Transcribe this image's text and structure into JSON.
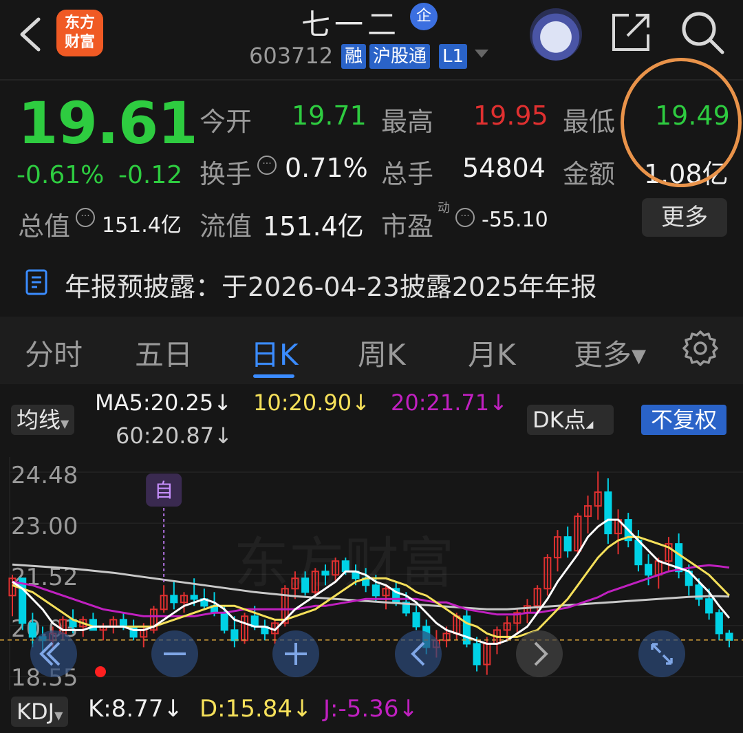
{
  "header": {
    "logo_line1": "东方",
    "logo_line2": "财富",
    "stock_name": "七一二",
    "enterprise_badge": "企",
    "stock_code": "603712",
    "tags": [
      "融",
      "沪股通",
      "L1"
    ]
  },
  "quote": {
    "price": "19.61",
    "change_pct": "-0.61%",
    "change_abs": "-0.12",
    "open_label": "今开",
    "open": "19.71",
    "high_label": "最高",
    "high": "19.95",
    "low_label": "最低",
    "low": "19.49",
    "turnover_label": "换手",
    "turnover": "0.71%",
    "volume_label": "总手",
    "volume": "54804",
    "amount_label": "金额",
    "amount": "1.08亿",
    "total_cap_label": "总值",
    "total_cap": "151.4亿",
    "float_cap_label": "流值",
    "float_cap": "151.4亿",
    "pe_label": "市盈",
    "pe_sup": "动",
    "pe": "-55.10",
    "more_label": "更多"
  },
  "notice": {
    "text": "年报预披露：于2026-04-23披露2025年年报"
  },
  "tabs": [
    {
      "label": "分时"
    },
    {
      "label": "五日"
    },
    {
      "label": "日K",
      "active": true
    },
    {
      "label": "周K"
    },
    {
      "label": "月K"
    },
    {
      "label": "更多▾"
    }
  ],
  "ma_legend": {
    "selector": "均线",
    "ma5": "MA5:20.25↓",
    "ma10": "10:20.90↓",
    "ma20": "20:21.71↓",
    "ma60": "60:20.87↓",
    "dk_label": "DK点",
    "adjust_label": "不复权"
  },
  "colors": {
    "up": "#e03030",
    "down": "#00d2e6",
    "price_green": "#2ecc40",
    "ma5": "#ffffff",
    "ma10": "#f5e05a",
    "ma20": "#c020c0",
    "ma60": "#c8c8c8",
    "accent": "#3b8cff"
  },
  "chart_data": {
    "type": "candlestick",
    "y_ticks": [
      "24.48",
      "23.00",
      "21.52",
      "20.03",
      "18.55"
    ],
    "ylim": [
      18.55,
      24.48
    ],
    "watermark": "东方财富",
    "marker_label": "自",
    "candles": [
      [
        20.9,
        21.5,
        20.3,
        21.4
      ],
      [
        21.4,
        21.4,
        19.9,
        20.1
      ],
      [
        20.1,
        20.4,
        19.4,
        19.7
      ],
      [
        19.7,
        20.0,
        19.3,
        19.6
      ],
      [
        19.6,
        20.0,
        19.3,
        19.8
      ],
      [
        19.8,
        20.3,
        19.6,
        20.2
      ],
      [
        20.2,
        20.5,
        19.8,
        20.0
      ],
      [
        20.0,
        20.3,
        19.7,
        20.2
      ],
      [
        20.2,
        20.4,
        19.9,
        19.9
      ],
      [
        19.9,
        20.1,
        19.6,
        20.0
      ],
      [
        20.0,
        20.3,
        19.8,
        20.2
      ],
      [
        20.2,
        20.4,
        19.9,
        20.0
      ],
      [
        20.0,
        20.2,
        19.6,
        19.7
      ],
      [
        19.7,
        20.1,
        19.4,
        19.9
      ],
      [
        19.9,
        20.6,
        19.8,
        20.5
      ],
      [
        20.5,
        21.2,
        20.4,
        20.9
      ],
      [
        20.9,
        21.3,
        20.5,
        20.7
      ],
      [
        20.7,
        21.0,
        20.4,
        20.9
      ],
      [
        20.9,
        21.4,
        20.6,
        20.8
      ],
      [
        20.8,
        21.1,
        20.5,
        20.6
      ],
      [
        20.6,
        21.0,
        20.3,
        20.4
      ],
      [
        20.4,
        20.6,
        19.8,
        19.9
      ],
      [
        19.9,
        20.3,
        19.4,
        19.6
      ],
      [
        19.6,
        20.4,
        19.5,
        20.3
      ],
      [
        20.3,
        20.6,
        19.9,
        20.0
      ],
      [
        20.0,
        20.2,
        19.6,
        19.8
      ],
      [
        19.8,
        20.2,
        19.5,
        20.1
      ],
      [
        20.1,
        21.2,
        20.0,
        21.1
      ],
      [
        21.1,
        21.6,
        20.8,
        21.4
      ],
      [
        21.4,
        21.6,
        20.9,
        21.0
      ],
      [
        21.0,
        21.7,
        20.9,
        21.6
      ],
      [
        21.6,
        21.8,
        21.2,
        21.5
      ],
      [
        21.5,
        22.0,
        21.3,
        21.9
      ],
      [
        21.9,
        22.0,
        21.5,
        21.6
      ],
      [
        21.6,
        21.8,
        21.2,
        21.4
      ],
      [
        21.4,
        21.7,
        21.0,
        21.2
      ],
      [
        21.2,
        21.5,
        20.7,
        20.9
      ],
      [
        20.9,
        21.2,
        20.5,
        21.1
      ],
      [
        21.1,
        21.3,
        20.6,
        20.7
      ],
      [
        20.7,
        21.0,
        20.3,
        20.4
      ],
      [
        20.4,
        20.6,
        19.9,
        20.0
      ],
      [
        20.0,
        20.2,
        19.2,
        19.4
      ],
      [
        19.4,
        19.9,
        19.1,
        19.6
      ],
      [
        19.6,
        20.0,
        19.4,
        19.8
      ],
      [
        19.8,
        20.4,
        19.6,
        20.3
      ],
      [
        20.3,
        20.5,
        19.4,
        19.5
      ],
      [
        19.5,
        19.7,
        18.7,
        18.9
      ],
      [
        18.9,
        19.7,
        18.6,
        19.5
      ],
      [
        19.5,
        20.0,
        19.2,
        19.9
      ],
      [
        19.9,
        20.3,
        19.6,
        20.1
      ],
      [
        20.1,
        20.5,
        19.8,
        20.4
      ],
      [
        20.4,
        20.8,
        20.1,
        20.6
      ],
      [
        20.6,
        21.2,
        20.4,
        21.1
      ],
      [
        21.1,
        22.1,
        20.9,
        22.0
      ],
      [
        22.0,
        22.8,
        21.6,
        22.6
      ],
      [
        22.6,
        22.9,
        22.0,
        22.2
      ],
      [
        22.2,
        23.3,
        22.1,
        23.2
      ],
      [
        23.2,
        23.8,
        22.7,
        23.5
      ],
      [
        23.5,
        24.5,
        23.1,
        23.9
      ],
      [
        23.9,
        24.3,
        22.4,
        22.7
      ],
      [
        22.7,
        23.4,
        22.1,
        23.1
      ],
      [
        23.1,
        23.3,
        22.3,
        22.5
      ],
      [
        22.5,
        22.8,
        21.6,
        21.8
      ],
      [
        21.8,
        22.1,
        21.2,
        21.5
      ],
      [
        21.5,
        22.0,
        21.1,
        21.9
      ],
      [
        21.9,
        22.6,
        21.6,
        22.4
      ],
      [
        22.4,
        22.7,
        21.4,
        21.6
      ],
      [
        21.6,
        21.8,
        20.9,
        21.2
      ],
      [
        21.2,
        21.4,
        20.6,
        20.8
      ],
      [
        20.8,
        21.1,
        20.2,
        20.4
      ],
      [
        20.4,
        20.5,
        19.6,
        19.8
      ],
      [
        19.8,
        19.9,
        19.4,
        19.61
      ]
    ],
    "ma5": [
      21.3,
      21.1,
      20.8,
      20.5,
      20.1,
      19.9,
      19.9,
      19.9,
      20.0,
      20.0,
      20.0,
      20.0,
      19.9,
      19.9,
      20.0,
      20.2,
      20.4,
      20.6,
      20.7,
      20.8,
      20.7,
      20.5,
      20.2,
      20.1,
      20.0,
      20.0,
      19.9,
      20.2,
      20.5,
      20.7,
      20.9,
      21.1,
      21.3,
      21.6,
      21.6,
      21.5,
      21.3,
      21.2,
      21.0,
      20.9,
      20.7,
      20.4,
      20.1,
      19.9,
      19.8,
      19.7,
      19.6,
      19.5,
      19.5,
      19.6,
      19.8,
      20.0,
      20.4,
      20.8,
      21.3,
      21.7,
      22.1,
      22.6,
      22.9,
      23.1,
      23.1,
      22.8,
      22.5,
      22.2,
      21.9,
      21.8,
      21.7,
      21.6,
      21.3,
      21.0,
      20.6,
      20.25
    ],
    "ma10": [
      21.2,
      21.1,
      21.0,
      20.8,
      20.6,
      20.4,
      20.2,
      20.1,
      20.0,
      20.0,
      20.0,
      20.0,
      20.0,
      20.0,
      20.0,
      20.1,
      20.2,
      20.3,
      20.4,
      20.5,
      20.6,
      20.6,
      20.6,
      20.5,
      20.4,
      20.3,
      20.2,
      20.2,
      20.3,
      20.4,
      20.5,
      20.7,
      20.9,
      21.1,
      21.3,
      21.4,
      21.4,
      21.4,
      21.3,
      21.2,
      21.0,
      20.9,
      20.7,
      20.5,
      20.3,
      20.1,
      20.0,
      19.8,
      19.7,
      19.7,
      19.7,
      19.8,
      19.9,
      20.2,
      20.5,
      20.8,
      21.2,
      21.6,
      22.0,
      22.3,
      22.5,
      22.6,
      22.6,
      22.5,
      22.4,
      22.3,
      22.1,
      21.9,
      21.7,
      21.5,
      21.2,
      20.9
    ],
    "ma20": [
      21.3,
      21.25,
      21.2,
      21.1,
      21.0,
      20.9,
      20.8,
      20.7,
      20.6,
      20.5,
      20.45,
      20.4,
      20.35,
      20.3,
      20.3,
      20.3,
      20.3,
      20.3,
      20.3,
      20.35,
      20.4,
      20.4,
      20.45,
      20.5,
      20.5,
      20.5,
      20.5,
      20.5,
      20.5,
      20.55,
      20.6,
      20.6,
      20.65,
      20.7,
      20.75,
      20.8,
      20.8,
      20.8,
      20.8,
      20.8,
      20.8,
      20.75,
      20.7,
      20.7,
      20.6,
      20.5,
      20.45,
      20.4,
      20.35,
      20.35,
      20.35,
      20.4,
      20.4,
      20.45,
      20.5,
      20.55,
      20.65,
      20.75,
      20.85,
      21.0,
      21.1,
      21.2,
      21.3,
      21.4,
      21.5,
      21.6,
      21.65,
      21.7,
      21.75,
      21.78,
      21.75,
      21.71
    ],
    "ma60": [
      21.8,
      21.78,
      21.76,
      21.74,
      21.72,
      21.7,
      21.68,
      21.65,
      21.62,
      21.59,
      21.56,
      21.52,
      21.48,
      21.44,
      21.4,
      21.36,
      21.32,
      21.28,
      21.24,
      21.2,
      21.16,
      21.12,
      21.08,
      21.04,
      21.0,
      20.97,
      20.94,
      20.91,
      20.88,
      20.86,
      20.84,
      20.82,
      20.8,
      20.78,
      20.76,
      20.74,
      20.72,
      20.7,
      20.68,
      20.66,
      20.64,
      20.62,
      20.6,
      20.58,
      20.56,
      20.54,
      20.52,
      20.5,
      20.5,
      20.5,
      20.52,
      20.54,
      20.56,
      20.58,
      20.6,
      20.62,
      20.64,
      20.66,
      20.68,
      20.7,
      20.72,
      20.74,
      20.76,
      20.78,
      20.8,
      20.82,
      20.84,
      20.86,
      20.87,
      20.88,
      20.88,
      20.87
    ],
    "last_close_line": 19.61
  },
  "kdj": {
    "selector": "KDJ",
    "k": "K:8.77↓",
    "d": "D:15.84↓",
    "j": "J:-5.36↓"
  }
}
